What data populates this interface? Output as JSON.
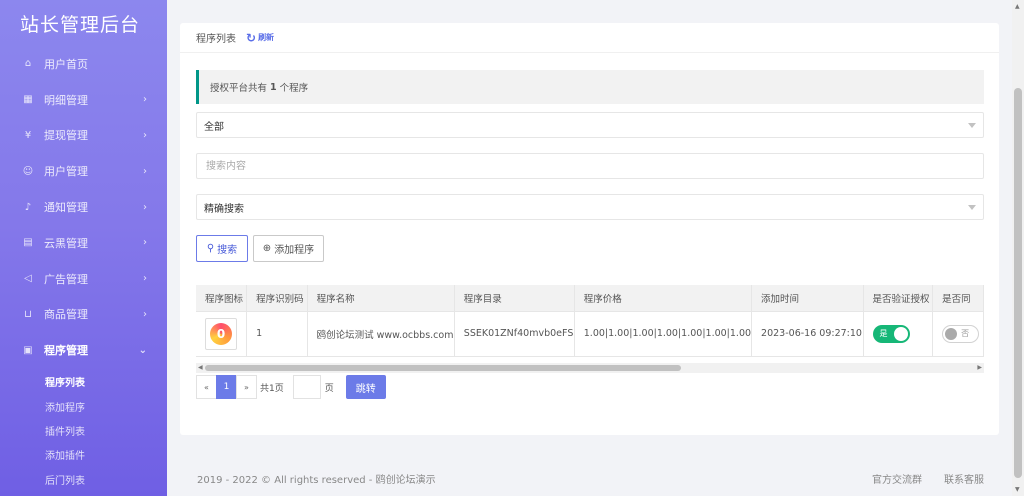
{
  "brand": "站长管理后台",
  "sidebar": {
    "items": [
      {
        "label": "用户首页",
        "icon": "home-icon",
        "glyph": "⌂",
        "chevron": ""
      },
      {
        "label": "明细管理",
        "icon": "grid-icon",
        "glyph": "▦",
        "chevron": "›"
      },
      {
        "label": "提现管理",
        "icon": "yuan-icon",
        "glyph": "¥",
        "chevron": "›"
      },
      {
        "label": "用户管理",
        "icon": "user-icon",
        "glyph": "☺",
        "chevron": "›"
      },
      {
        "label": "通知管理",
        "icon": "bell-icon",
        "glyph": "♪",
        "chevron": "›"
      },
      {
        "label": "云黑管理",
        "icon": "document-icon",
        "glyph": "▤",
        "chevron": "›"
      },
      {
        "label": "广告管理",
        "icon": "speaker-icon",
        "glyph": "◁",
        "chevron": "›"
      },
      {
        "label": "商品管理",
        "icon": "cart-icon",
        "glyph": "⊔",
        "chevron": "›"
      },
      {
        "label": "程序管理",
        "icon": "apps-icon",
        "glyph": "▣",
        "chevron": "⌄"
      }
    ],
    "subitems": [
      "程序列表",
      "添加程序",
      "插件列表",
      "添加插件",
      "后门列表"
    ]
  },
  "header": {
    "title": "程序列表",
    "refresh": "刷新"
  },
  "notice": {
    "prefix": "授权平台共有",
    "count": "1",
    "suffix": "个程序"
  },
  "filters": {
    "category_value": "全部",
    "search_placeholder": "搜索内容",
    "mode_value": "精确搜索"
  },
  "buttons": {
    "search": "搜索",
    "add": "添加程序"
  },
  "table": {
    "columns": [
      "程序图标",
      "程序识别码",
      "程序名称",
      "程序目录",
      "程序价格",
      "添加时间",
      "是否验证授权",
      "是否同"
    ],
    "rows": [
      {
        "id": "1",
        "name": "鸥创论坛测试 www.ocbbs.com",
        "dir": "SSEK01ZNf40mvb0eFS",
        "price": "1.00|1.00|1.00|1.00|1.00|1.00|1.00",
        "time": "2023-06-16 09:27:10",
        "verify": "是",
        "sync": "否"
      }
    ]
  },
  "pager": {
    "prev": "«",
    "current": "1",
    "next": "»",
    "total": "共1页",
    "page_unit": "页",
    "jump": "跳转"
  },
  "footer": {
    "copyright": "2019 - 2022 © All rights reserved - 鸥创论坛演示",
    "links": [
      "官方交流群",
      "联系客服"
    ]
  }
}
